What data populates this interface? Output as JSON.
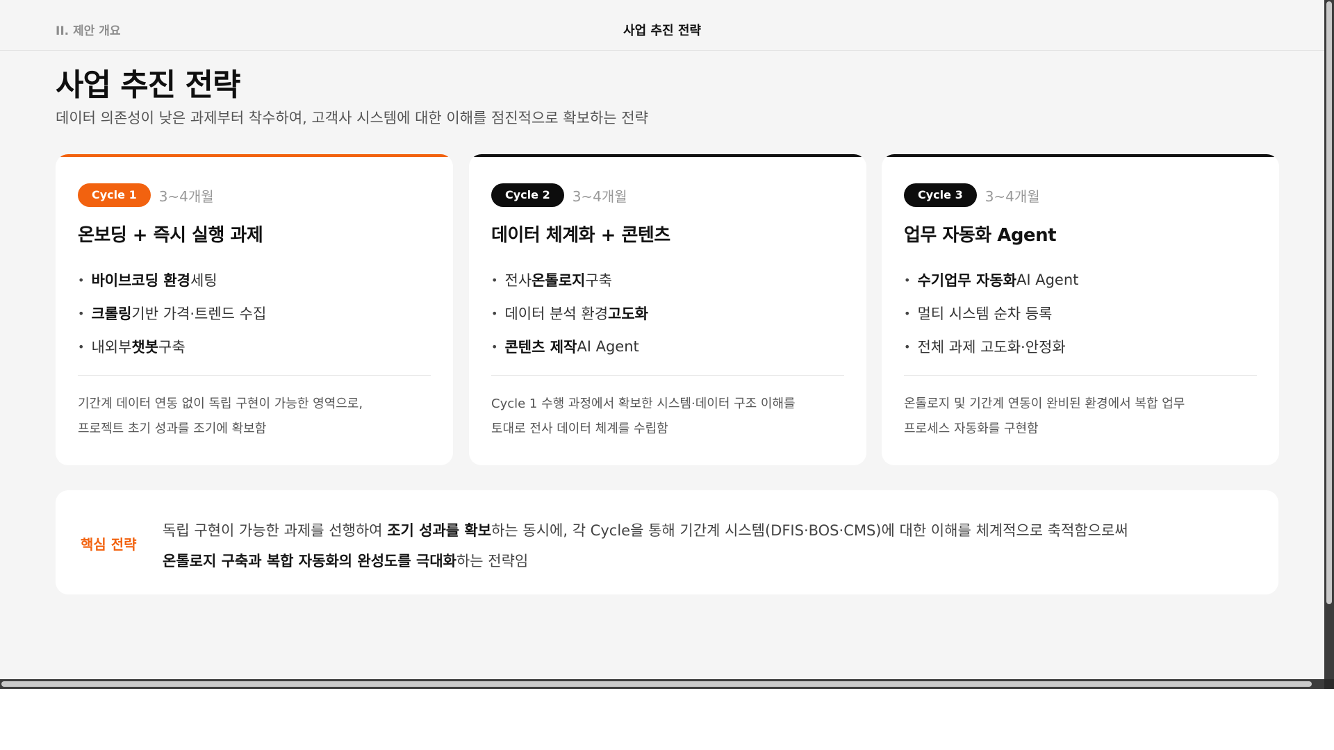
{
  "header": {
    "section_label": "II. 제안 개요",
    "title": "사업 추진 전략"
  },
  "page": {
    "title": "사업 추진 전략",
    "subtitle": "데이터 의존성이 낮은 과제부터 착수하여, 고객사 시스템에 대한 이해를 점진적으로 확보하는 전략"
  },
  "cards": [
    {
      "badge": "Cycle 1",
      "duration": "3~4개월",
      "title": "온보딩 + 즉시 실행 과제",
      "bullets": [
        {
          "pre": "",
          "bold": "바이브코딩 환경",
          "post": " 세팅"
        },
        {
          "pre": "",
          "bold": "크롤링",
          "post": " 기반 가격·트렌드 수집"
        },
        {
          "pre": "내외부 ",
          "bold": "챗봇",
          "post": " 구축"
        }
      ],
      "desc1": "기간계 데이터 연동 없이 독립 구현이 가능한 영역으로,",
      "desc2": "프로젝트 초기 성과를 조기에 확보함"
    },
    {
      "badge": "Cycle 2",
      "duration": "3~4개월",
      "title": "데이터 체계화 + 콘텐츠",
      "bullets": [
        {
          "pre": "전사 ",
          "bold": "온톨로지",
          "post": " 구축"
        },
        {
          "pre": "데이터 분석 환경 ",
          "bold": "고도화",
          "post": ""
        },
        {
          "pre": "",
          "bold": "콘텐츠 제작",
          "post": " AI Agent"
        }
      ],
      "desc1": "Cycle 1 수행 과정에서 확보한 시스템·데이터 구조 이해를",
      "desc2": "토대로 전사 데이터 체계를 수립함"
    },
    {
      "badge": "Cycle 3",
      "duration": "3~4개월",
      "title": "업무 자동화 Agent",
      "bullets": [
        {
          "pre": "",
          "bold": "수기업무 자동화",
          "post": " AI Agent"
        },
        {
          "pre": "멀티 시스템 순차 등록",
          "bold": "",
          "post": ""
        },
        {
          "pre": "전체 과제 고도화·안정화",
          "bold": "",
          "post": ""
        }
      ],
      "desc1": "온톨로지 및 기간계 연동이 완비된 환경에서 복합 업무",
      "desc2": "프로세스 자동화를 구현함"
    }
  ],
  "key_strategy": {
    "label": "핵심 전략",
    "line1_pre": "독립 구현이 가능한 과제를 선행하여 ",
    "line1_bold": "조기 성과를 확보",
    "line1_post": "하는 동시에, 각 Cycle을 통해 기간계 시스템(DFIS·BOS·CMS)에 대한 이해를 체계적으로 축적함으로써",
    "line2_bold": "온톨로지 구축과 복합 자동화의 완성도를 극대화",
    "line2_post": "하는 전략임"
  },
  "colors": {
    "accent": "#f2620f",
    "dark": "#0d0d0d",
    "background": "#f5f5f5"
  }
}
